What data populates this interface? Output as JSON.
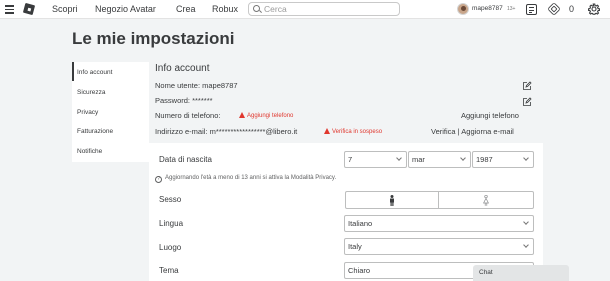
{
  "topbar": {
    "nav": [
      "Scopri",
      "Negozio Avatar",
      "Crea",
      "Robux"
    ],
    "search_placeholder": "Cerca",
    "username": "mape8787",
    "age_badge": "13+",
    "robux_count": "0"
  },
  "page": {
    "title": "Le mie impostazioni"
  },
  "sidebar": {
    "items": [
      {
        "label": "Info account"
      },
      {
        "label": "Sicurezza"
      },
      {
        "label": "Privacy"
      },
      {
        "label": "Fatturazione"
      },
      {
        "label": "Notifiche"
      }
    ]
  },
  "account": {
    "section_title": "Info account",
    "username_line": "Nome utente: mape8787",
    "password_line": "Password: *******",
    "phone_label": "Numero di telefono:",
    "phone_warning": "Aggiungi telefono",
    "phone_action": "Aggiungi telefono",
    "email_label": "Indirizzo e-mail: m*****************@libero.it",
    "email_warning": "Verifica in sospeso",
    "email_action": "Verifica | Aggiorna e-mail"
  },
  "personal": {
    "birthdate_label": "Data di nascita",
    "birth_day": "7",
    "birth_month": "mar",
    "birth_year": "1987",
    "privacy_hint": "Aggiornando l'età a meno di 13 anni si attiva la Modalità Privacy.",
    "gender_label": "Sesso",
    "language_label": "Lingua",
    "language_value": "Italiano",
    "location_label": "Luogo",
    "location_value": "Italy",
    "theme_label": "Tema",
    "theme_value": "Chiaro"
  },
  "chat": {
    "label": "Chat"
  }
}
